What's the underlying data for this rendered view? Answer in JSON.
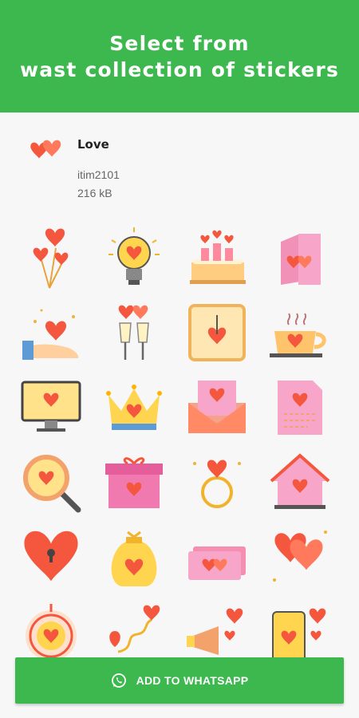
{
  "banner": {
    "line1": "Select from",
    "line2": "wast collection of stickers"
  },
  "pack": {
    "title": "Love",
    "author": "itim2101",
    "size": "216 kB",
    "icon": "hearts-icon"
  },
  "stickers": [
    "heart-balloons-icon",
    "heart-lightbulb-icon",
    "birthday-cake-icon",
    "love-card-icon",
    "hand-heart-icon",
    "champagne-toast-icon",
    "heart-clock-icon",
    "coffee-cup-heart-icon",
    "monitor-heart-icon",
    "crown-heart-icon",
    "love-letter-envelope-icon",
    "love-document-icon",
    "magnifier-heart-icon",
    "gift-box-heart-icon",
    "heart-ring-icon",
    "birdhouse-heart-icon",
    "heart-lock-icon",
    "money-bag-heart-icon",
    "love-tickets-icon",
    "two-hearts-icon",
    "heart-target-icon",
    "location-pin-heart-icon",
    "megaphone-hearts-icon",
    "phone-heart-icon"
  ],
  "add_button": {
    "label": "ADD TO WHATSAPP",
    "icon": "whatsapp-icon"
  },
  "colors": {
    "brand_green": "#3db84e",
    "heart_red": "#f4573e"
  }
}
